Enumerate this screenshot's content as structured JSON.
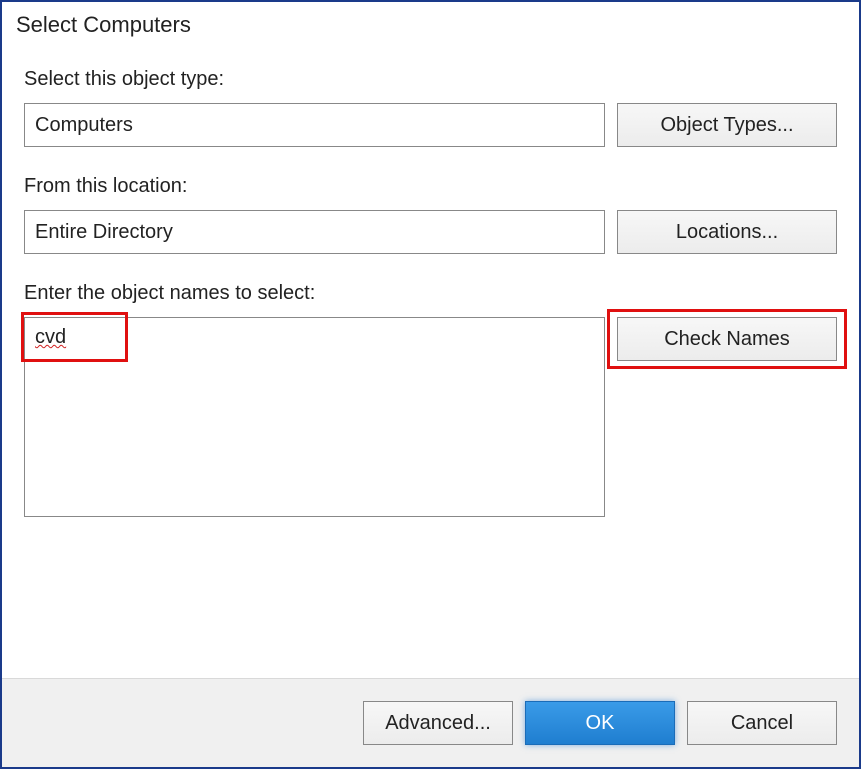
{
  "dialog": {
    "title": "Select Computers"
  },
  "objectType": {
    "label": "Select this object type:",
    "value": "Computers",
    "button": "Object Types..."
  },
  "location": {
    "label": "From this location:",
    "value": "Entire Directory",
    "button": "Locations..."
  },
  "names": {
    "label": "Enter the object names to select:",
    "value": "cvd",
    "button": "Check Names"
  },
  "footer": {
    "advanced": "Advanced...",
    "ok": "OK",
    "cancel": "Cancel"
  }
}
